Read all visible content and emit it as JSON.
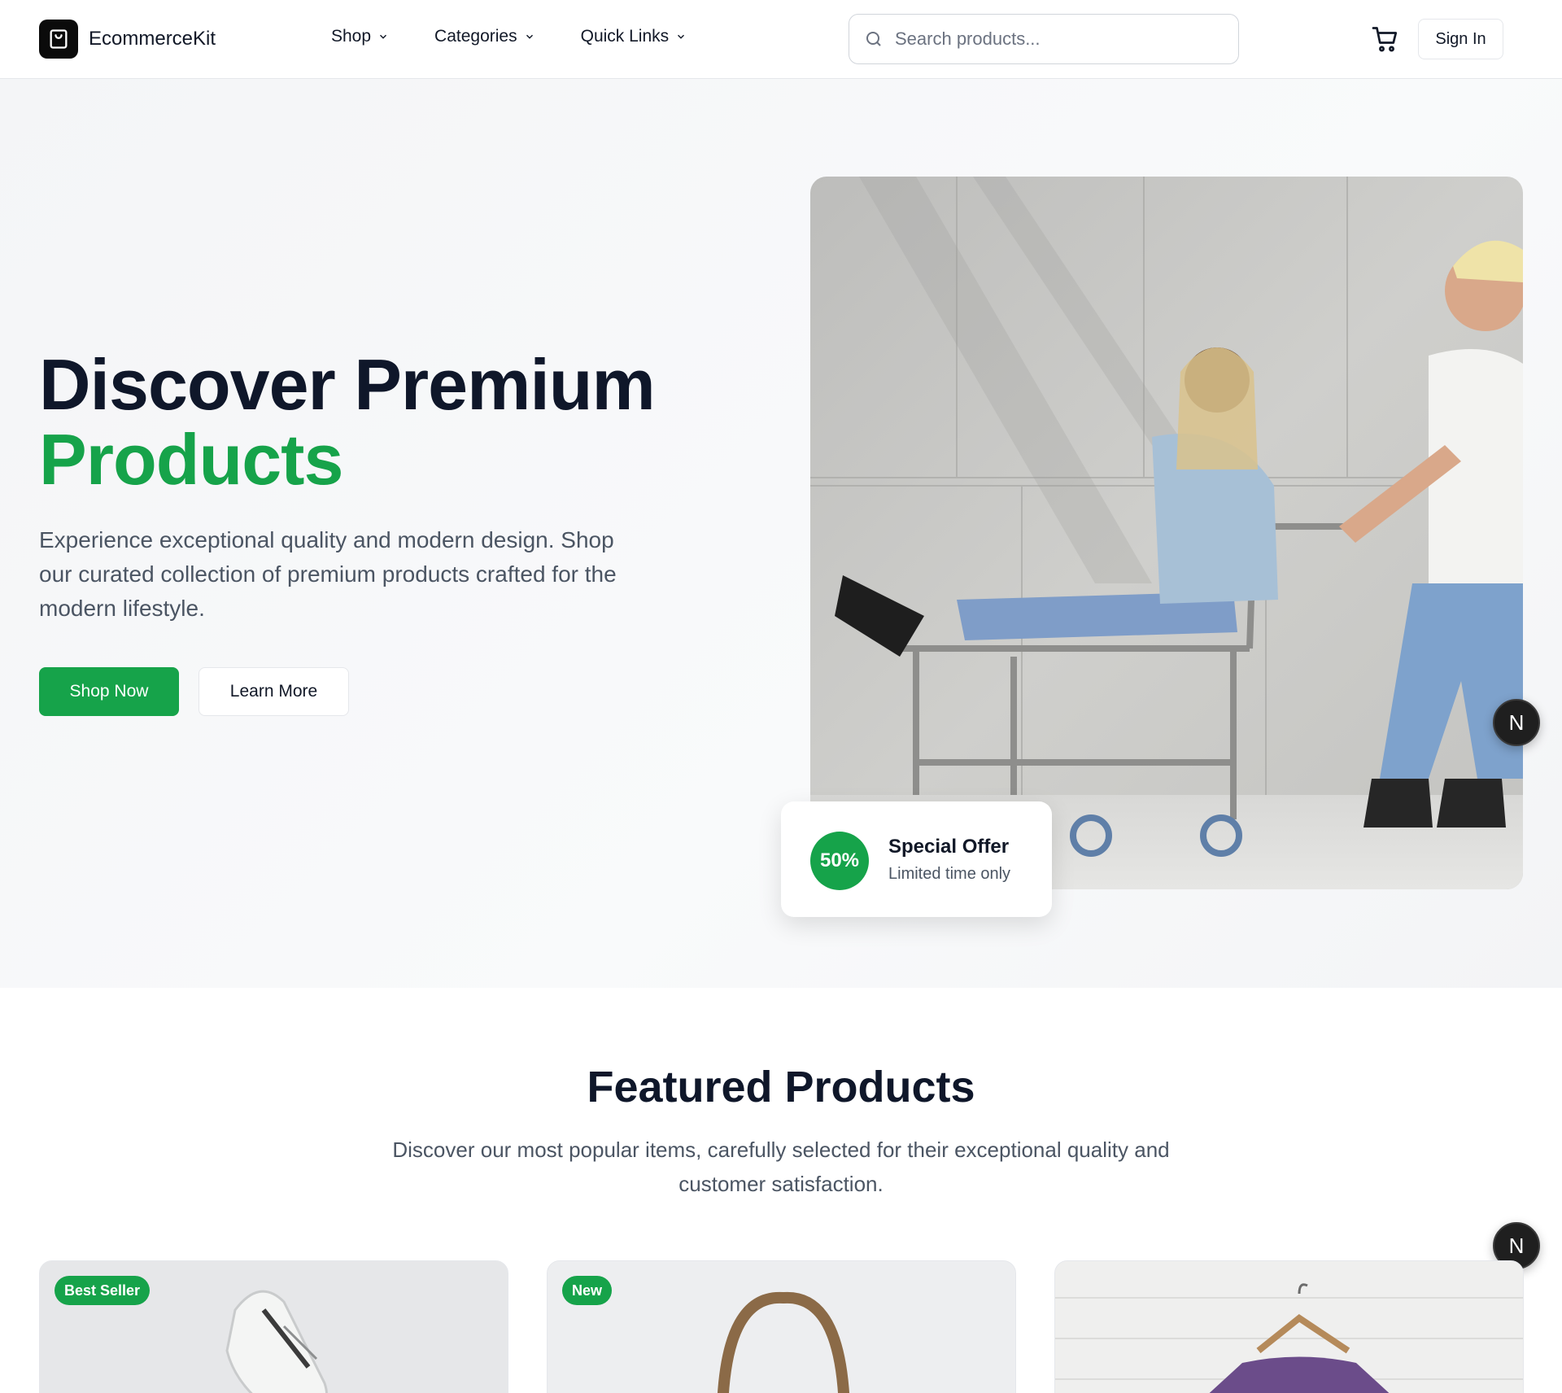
{
  "header": {
    "brand": "EcommerceKit",
    "nav": [
      {
        "label": "Shop"
      },
      {
        "label": "Categories"
      },
      {
        "label": "Quick Links"
      }
    ],
    "search_placeholder": "Search products...",
    "sign_in": "Sign In"
  },
  "hero": {
    "title_line1": "Discover Premium",
    "title_line2": "Products",
    "description": "Experience exceptional quality and modern design. Shop our curated collection of premium products crafted for the modern lifestyle.",
    "primary_button": "Shop Now",
    "secondary_button": "Learn More",
    "offer": {
      "badge": "50%",
      "title": "Special Offer",
      "subtitle": "Limited time only"
    }
  },
  "floating_badge": "N",
  "featured": {
    "title": "Featured Products",
    "description": "Discover our most popular items, carefully selected for their exceptional quality and customer satisfaction.",
    "products": [
      {
        "badge": "Best Seller",
        "icon": "sneaker-image"
      },
      {
        "badge": "New",
        "icon": "bag-image"
      },
      {
        "badge": "",
        "icon": "tshirt-image"
      }
    ]
  },
  "colors": {
    "accent": "#16a34a",
    "heading": "#0f172a",
    "body_text": "#4b5563"
  }
}
